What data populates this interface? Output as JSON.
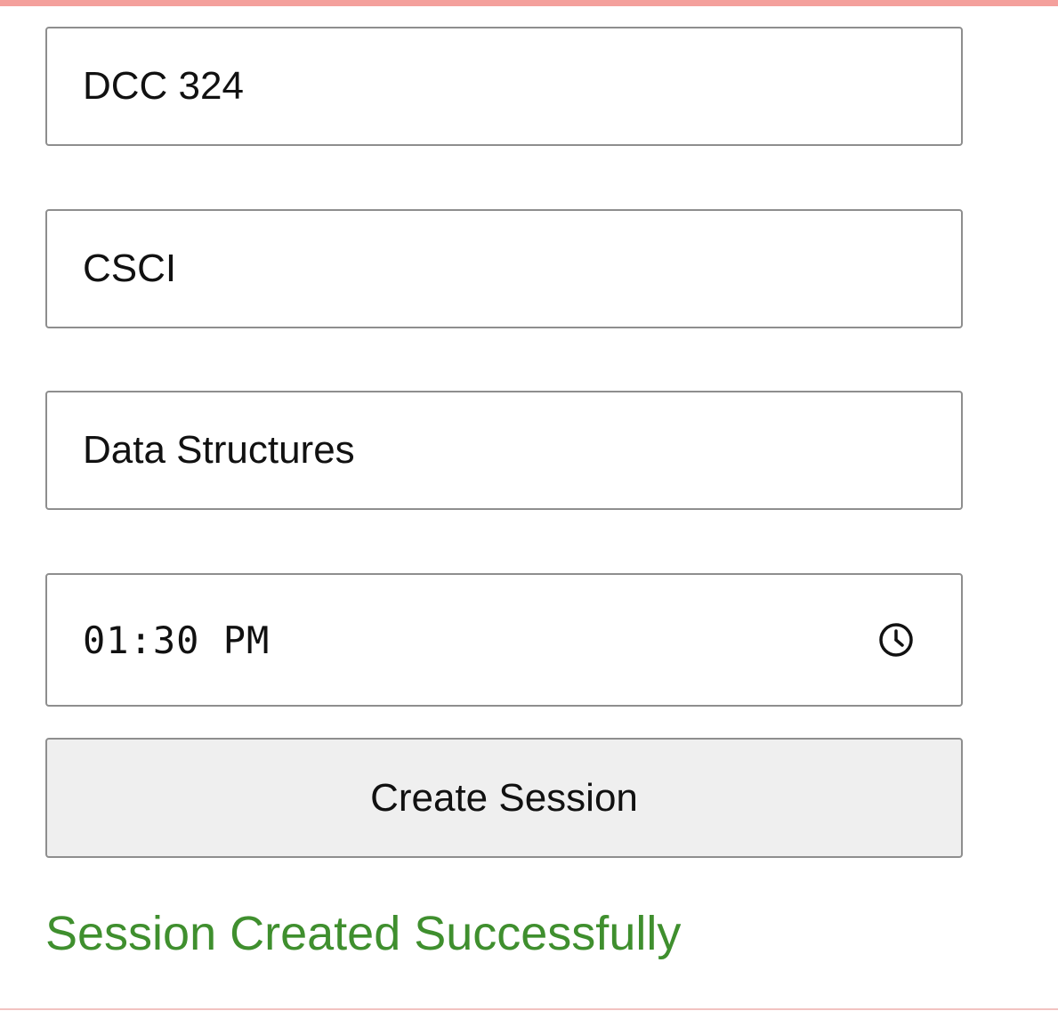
{
  "form": {
    "room_value": "DCC 324",
    "department_value": "CSCI",
    "course_value": "Data Structures",
    "time_value": "01:30 PM",
    "time_icon": "clock-icon",
    "submit_label": "Create Session",
    "status_message": "Session Created Successfully"
  },
  "colors": {
    "top_bar": "#f4a09c",
    "field_border": "#8e8e8e",
    "button_background": "#efefef",
    "success_text": "#3f8f2e"
  }
}
